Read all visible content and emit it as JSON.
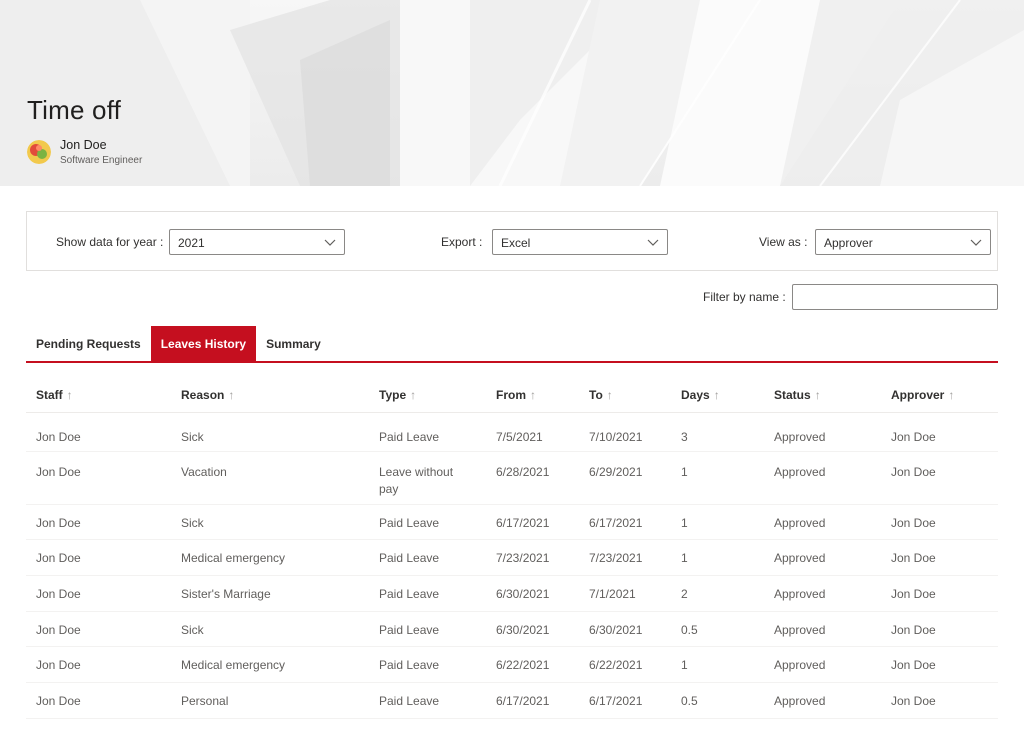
{
  "page": {
    "title": "Time off",
    "user_name": "Jon Doe",
    "user_title": "Software Engineer"
  },
  "filters": {
    "year_label": "Show data for year :",
    "year_value": "2021",
    "export_label": "Export :",
    "export_value": "Excel",
    "view_label": "View as :",
    "view_value": "Approver",
    "name_label": "Filter by name :",
    "name_value": ""
  },
  "tabs": [
    {
      "label": "Pending Requests",
      "active": false
    },
    {
      "label": "Leaves History",
      "active": true
    },
    {
      "label": "Summary",
      "active": false
    }
  ],
  "table": {
    "columns": [
      "Staff",
      "Reason",
      "Type",
      "From",
      "To",
      "Days",
      "Status",
      "Approver"
    ],
    "rows": [
      [
        "Jon Doe",
        "Sick",
        "Paid Leave",
        "7/5/2021",
        "7/10/2021",
        "3",
        "Approved",
        "Jon Doe"
      ],
      [
        "Jon Doe",
        "Vacation",
        "Leave without pay",
        "6/28/2021",
        "6/29/2021",
        "1",
        "Approved",
        "Jon Doe"
      ],
      [
        "Jon Doe",
        "Sick",
        "Paid Leave",
        "6/17/2021",
        "6/17/2021",
        "1",
        "Approved",
        "Jon Doe"
      ],
      [
        "Jon Doe",
        "Medical emergency",
        "Paid Leave",
        "7/23/2021",
        "7/23/2021",
        "1",
        "Approved",
        "Jon Doe"
      ],
      [
        "Jon Doe",
        "Sister's Marriage",
        "Paid Leave",
        "6/30/2021",
        "7/1/2021",
        "2",
        "Approved",
        "Jon Doe"
      ],
      [
        "Jon Doe",
        "Sick",
        "Paid Leave",
        "6/30/2021",
        "6/30/2021",
        "0.5",
        "Approved",
        "Jon Doe"
      ],
      [
        "Jon Doe",
        "Medical emergency",
        "Paid Leave",
        "6/22/2021",
        "6/22/2021",
        "1",
        "Approved",
        "Jon Doe"
      ],
      [
        "Jon Doe",
        "Personal",
        "Paid Leave",
        "6/17/2021",
        "6/17/2021",
        "0.5",
        "Approved",
        "Jon Doe"
      ]
    ]
  },
  "icons": {
    "sort": "sort-arrow-up-icon",
    "dropdown": "chevron-down-icon"
  },
  "colors": {
    "accent": "#c50f1f"
  }
}
